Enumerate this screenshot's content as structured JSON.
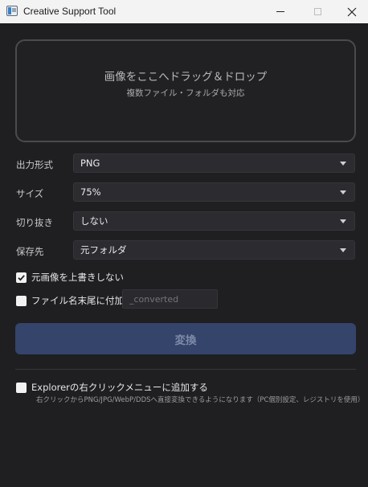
{
  "window": {
    "title": "Creative Support Tool",
    "controls": {
      "minimize": "minimize",
      "maximize": "maximize",
      "close": "close"
    }
  },
  "dropzone": {
    "main_text": "画像をここへドラッグ＆ドロップ",
    "sub_text": "複数ファイル・フォルダも対応"
  },
  "fields": {
    "format": {
      "label": "出力形式",
      "value": "PNG"
    },
    "size": {
      "label": "サイズ",
      "value": "75%"
    },
    "crop": {
      "label": "切り抜き",
      "value": "しない"
    },
    "destination": {
      "label": "保存先",
      "value": "元フォルダ"
    }
  },
  "options": {
    "no_overwrite": {
      "label": "元画像を上書きしない",
      "checked": true
    },
    "add_suffix": {
      "label": "ファイル名末尾に付加",
      "checked": false,
      "placeholder": "_converted"
    }
  },
  "convert_button": {
    "label": "変換"
  },
  "explorer": {
    "label": "Explorerの右クリックメニューに追加する",
    "checked": false,
    "note": "右クリックからPNG/JPG/WebP/DDSへ直接変換できるようになります（PC個別設定、レジストリを使用）"
  },
  "colors": {
    "background": "#1f1f21",
    "accent_button": "#34446b",
    "titlebar": "#f3f3f3"
  }
}
